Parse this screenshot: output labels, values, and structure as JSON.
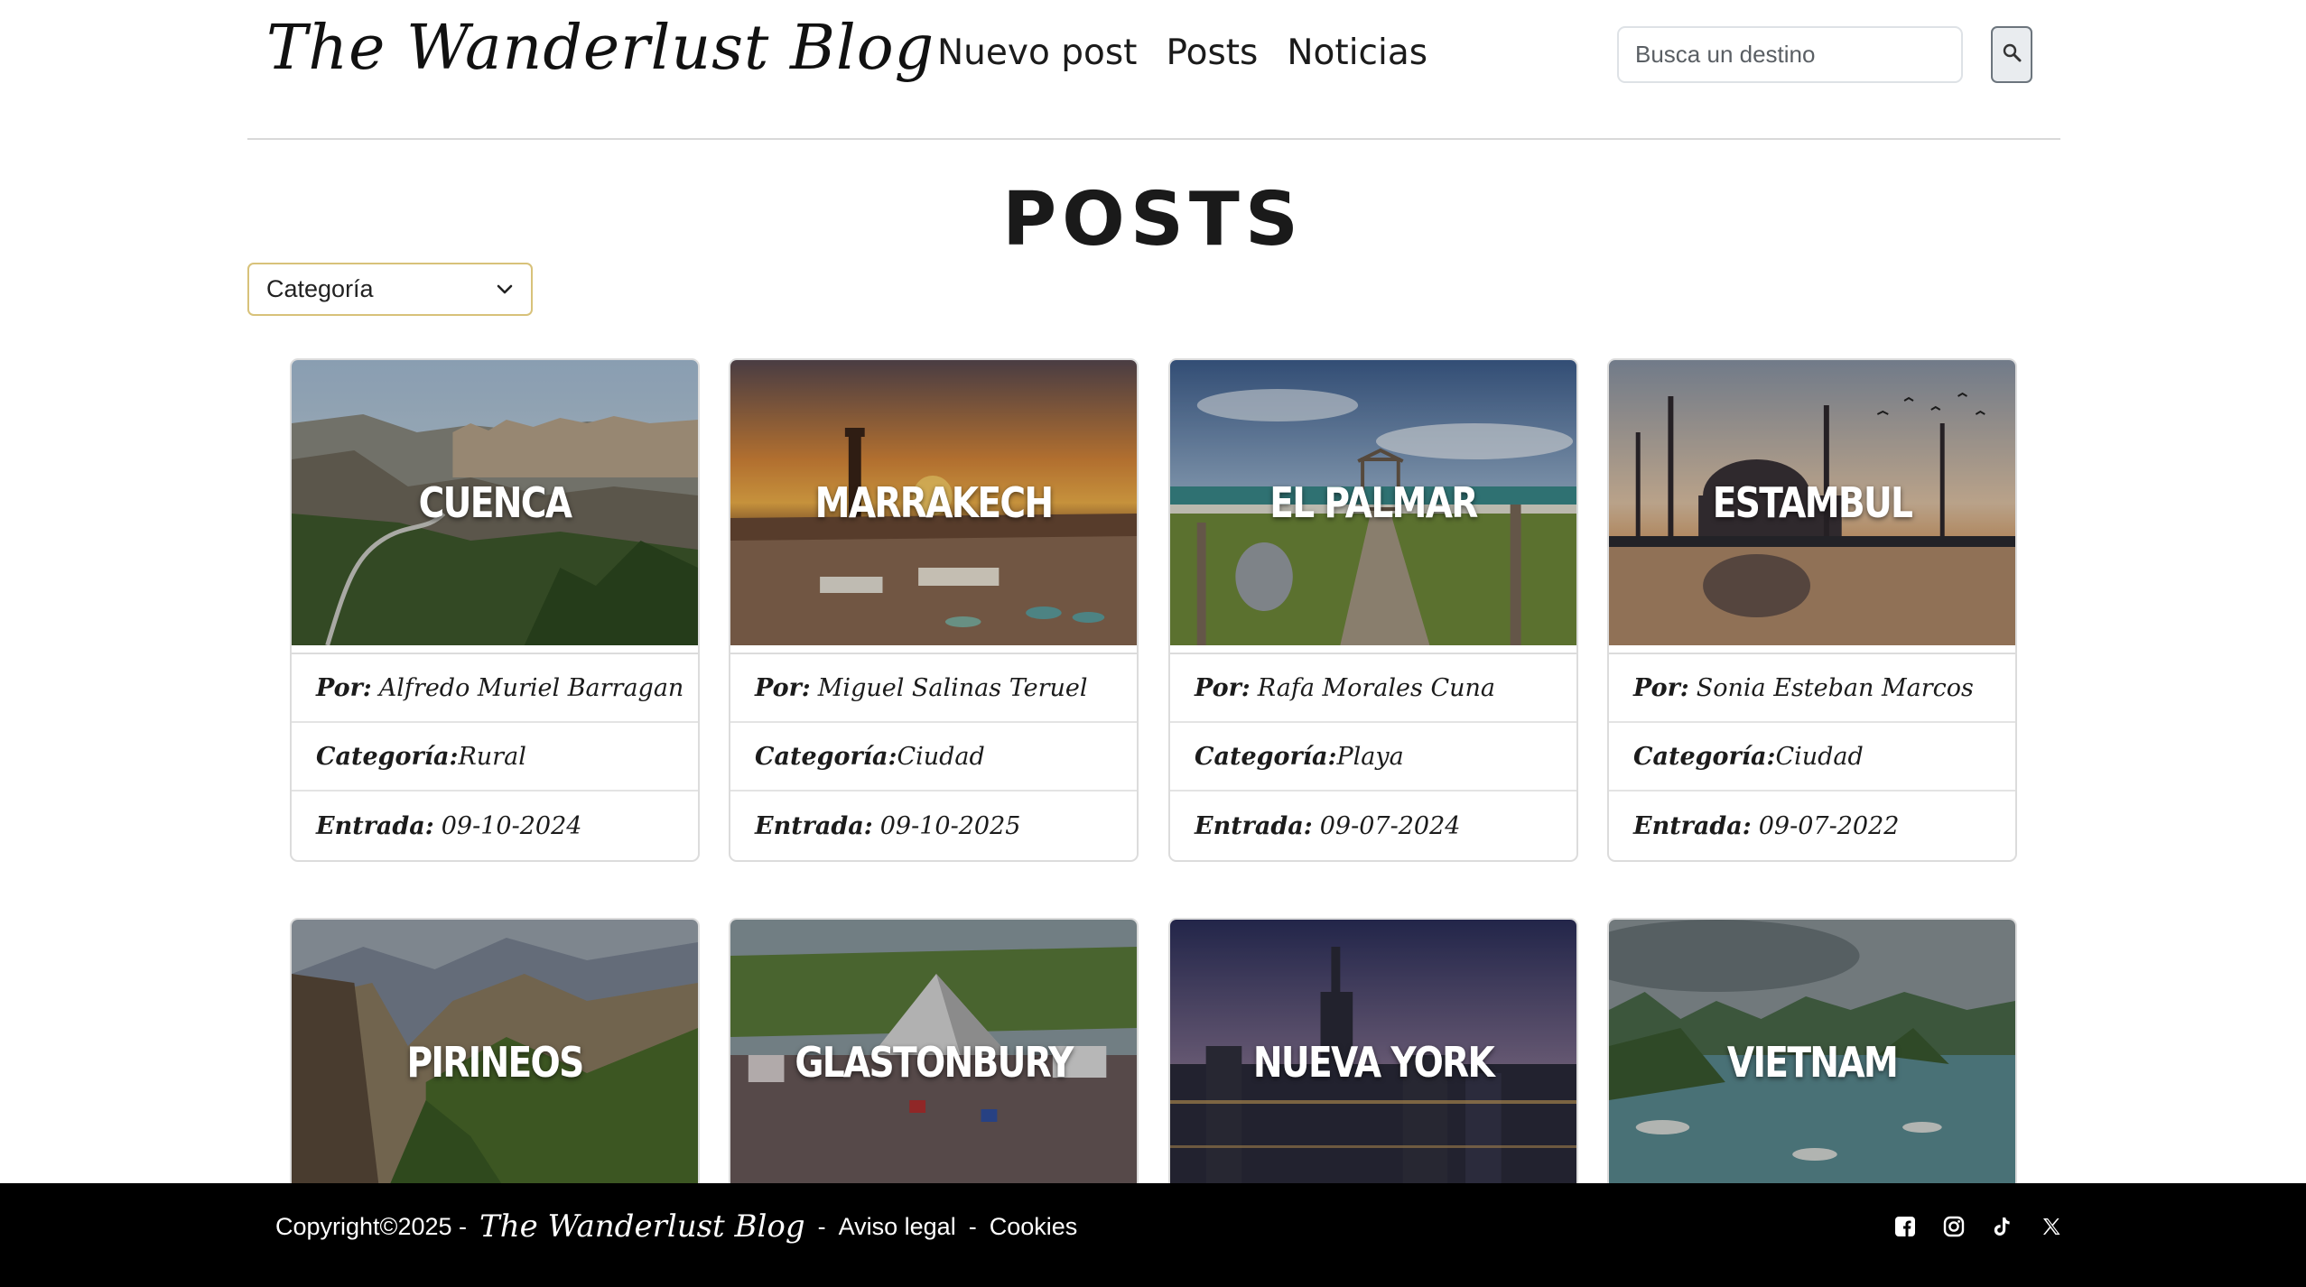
{
  "header": {
    "logo": "The Wanderlust Blog",
    "nav": [
      "Nuevo post",
      "Posts",
      "Noticias"
    ],
    "search": {
      "placeholder": "Busca un destino",
      "button_icon": "search-icon"
    }
  },
  "main": {
    "title": "POSTS",
    "filter": {
      "selected": "Categoría",
      "icon": "chevron-down-icon"
    },
    "labels": {
      "author": "Por:",
      "category": "Categoría:",
      "entry": "Entrada:"
    },
    "posts": [
      {
        "title": "CUENCA",
        "author": "Alfredo Muriel Barragan",
        "category": "Rural",
        "date": "09-10-2024"
      },
      {
        "title": "MARRAKECH",
        "author": "Miguel Salinas Teruel",
        "category": "Ciudad",
        "date": "09-10-2025"
      },
      {
        "title": "EL PALMAR",
        "author": "Rafa Morales Cuna",
        "category": "Playa",
        "date": "09-07-2024"
      },
      {
        "title": "ESTAMBUL",
        "author": "Sonia Esteban Marcos",
        "category": "Ciudad",
        "date": "09-07-2022"
      },
      {
        "title": "PIRINEOS"
      },
      {
        "title": "GLASTONBURY"
      },
      {
        "title": "NUEVA YORK"
      },
      {
        "title": "VIETNAM"
      }
    ]
  },
  "footer": {
    "copyright": "Copyright©2025 -",
    "brand": "The Wanderlust Blog",
    "brand_sep": "-",
    "legal": "Aviso legal",
    "legal_sep": "-",
    "cookies": "Cookies",
    "social_icons": [
      "facebook-icon",
      "instagram-icon",
      "tiktok-icon",
      "x-icon"
    ]
  }
}
